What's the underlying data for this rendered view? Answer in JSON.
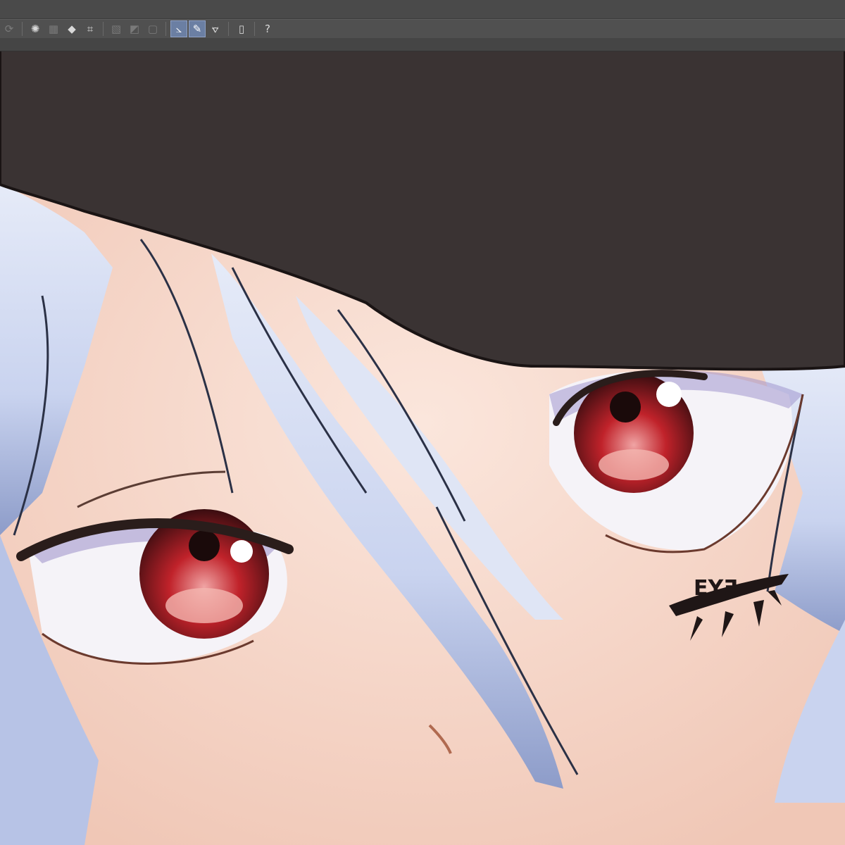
{
  "toolbar": {
    "tools": [
      {
        "icon": "redo-icon",
        "glyph": "⟳",
        "state": "dim"
      },
      {
        "icon": "sparkle-select-icon",
        "glyph": "✺",
        "state": "normal"
      },
      {
        "icon": "selection-grid-icon",
        "glyph": "▦",
        "state": "dim"
      },
      {
        "icon": "fill-bucket-icon",
        "glyph": "◆",
        "state": "normal"
      },
      {
        "icon": "transform-icon",
        "glyph": "⌗",
        "state": "normal"
      },
      {
        "icon": "hatch-pattern-icon",
        "glyph": "▧",
        "state": "dim"
      },
      {
        "icon": "gradient-icon",
        "glyph": "◩",
        "state": "dim"
      },
      {
        "icon": "frame-icon",
        "glyph": "▢",
        "state": "dim"
      },
      {
        "icon": "pen-pressure-icon",
        "glyph": "⦣",
        "state": "active"
      },
      {
        "icon": "brush-stabilizer-icon",
        "glyph": "✎",
        "state": "active"
      },
      {
        "icon": "ruler-pen-icon",
        "glyph": "⦡",
        "state": "normal"
      },
      {
        "icon": "device-icon",
        "glyph": "▯",
        "state": "normal"
      },
      {
        "icon": "help-lasso-icon",
        "glyph": "?",
        "state": "normal"
      }
    ]
  },
  "artwork": {
    "subject": "close-up of silver-blue haired anime character with red eyes under a dark cap",
    "cheek_mark_text": "EYƎ",
    "colors": {
      "cap": "#3a3333",
      "skin": "#f6d9cc",
      "skin_shadow": "#e9b7a3",
      "hair": "#c9d3ef",
      "hair_shadow": "#8d9cc9",
      "hair_line": "#2b3146",
      "iris": "#c0222a",
      "iris_light": "#e88a8a",
      "sclera": "#f5f3f8",
      "lash": "#2a1d1b",
      "eyeshadow": "#9a8ec9"
    }
  }
}
